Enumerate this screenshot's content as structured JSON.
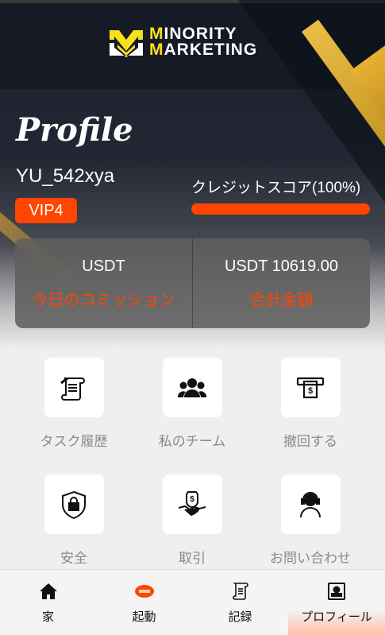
{
  "header": {
    "logo_line1": "MINORITY",
    "logo_line2": "MARKETING",
    "accent_color": "#f7e01d"
  },
  "profile": {
    "title": "Profile",
    "username": "YU_542xya",
    "vip_badge": "VIP4",
    "credit_label": "クレジットスコア(100%)",
    "credit_score_fraction": 1.0
  },
  "stats": {
    "today_commission_value": "USDT",
    "today_commission_label": "今日のコミッション",
    "total_value": "USDT 10619.00",
    "total_label": "合計金額"
  },
  "menu": {
    "items": [
      {
        "label": "タスク履歴",
        "icon": "scroll-icon"
      },
      {
        "label": "私のチーム",
        "icon": "team-icon"
      },
      {
        "label": "撤回する",
        "icon": "cash-withdraw-icon"
      },
      {
        "label": "安全",
        "icon": "shield-lock-icon"
      },
      {
        "label": "取引",
        "icon": "handshake-icon"
      },
      {
        "label": "お問い合わせ",
        "icon": "support-agent-icon"
      }
    ]
  },
  "tabbar": {
    "items": [
      {
        "label": "家",
        "icon": "home-icon"
      },
      {
        "label": "起動",
        "icon": "start-badge-icon"
      },
      {
        "label": "記録",
        "icon": "record-icon"
      },
      {
        "label": "プロフィール",
        "icon": "profile-card-icon",
        "active": true
      }
    ]
  },
  "colors": {
    "accent": "#ff4500",
    "background": "#efefef"
  }
}
